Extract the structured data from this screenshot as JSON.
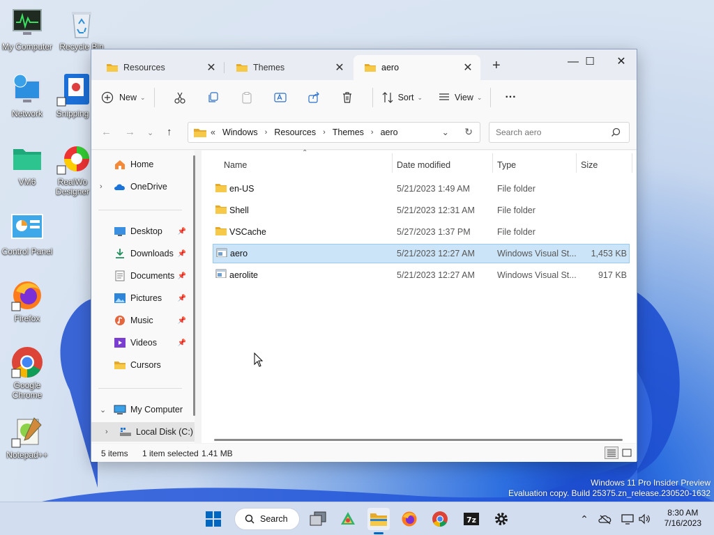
{
  "desktop": {
    "icons": [
      {
        "label": "My Computer",
        "icon": "monitor-icon"
      },
      {
        "label": "Recycle Bin",
        "icon": "recycle-bin-icon"
      },
      {
        "label": "Network",
        "icon": "network-icon"
      },
      {
        "label": "Snipping",
        "icon": "snipping-tool-icon"
      },
      {
        "label": "VM6",
        "icon": "folder-icon"
      },
      {
        "label": "RealWo Designer",
        "icon": "realworld-designer-icon"
      },
      {
        "label": "Control Panel",
        "icon": "control-panel-icon"
      },
      {
        "label": "Firefox",
        "icon": "firefox-icon"
      },
      {
        "label": "Google Chrome",
        "icon": "chrome-icon"
      },
      {
        "label": "Notepad++",
        "icon": "notepadpp-icon"
      }
    ],
    "watermark_line1": "Windows 11 Pro Insider Preview",
    "watermark_line2": "Evaluation copy. Build 25375.zn_release.230520-1632"
  },
  "window": {
    "tabs": [
      {
        "label": "Resources",
        "close": "✕"
      },
      {
        "label": "Themes",
        "close": "✕"
      },
      {
        "label": "aero",
        "close": "✕"
      }
    ],
    "new_tab": "+",
    "controls": {
      "minimize": "—",
      "maximize": "☐",
      "close": "✕"
    },
    "toolbar": {
      "new_label": "New",
      "sort_label": "Sort",
      "view_label": "View",
      "more_label": "···"
    },
    "address": {
      "overflow": "«",
      "crumbs": [
        "Windows",
        "Resources",
        "Themes",
        "aero"
      ],
      "search_placeholder": "Search aero"
    },
    "sidebar": {
      "home": "Home",
      "onedrive": "OneDrive",
      "quick_access": [
        {
          "label": "Desktop",
          "pinned": true
        },
        {
          "label": "Downloads",
          "pinned": true
        },
        {
          "label": "Documents",
          "pinned": true
        },
        {
          "label": "Pictures",
          "pinned": true
        },
        {
          "label": "Music",
          "pinned": true
        },
        {
          "label": "Videos",
          "pinned": true
        },
        {
          "label": "Cursors",
          "pinned": false
        }
      ],
      "my_computer": "My Computer",
      "local_disk": "Local Disk (C:)"
    },
    "columns": {
      "name": "Name",
      "date": "Date modified",
      "type": "Type",
      "size": "Size"
    },
    "files": [
      {
        "name": "en-US",
        "date": "5/21/2023 1:49 AM",
        "type": "File folder",
        "size": "",
        "kind": "folder"
      },
      {
        "name": "Shell",
        "date": "5/21/2023 12:31 AM",
        "type": "File folder",
        "size": "",
        "kind": "folder"
      },
      {
        "name": "VSCache",
        "date": "5/27/2023 1:37 PM",
        "type": "File folder",
        "size": "",
        "kind": "folder"
      },
      {
        "name": "aero",
        "date": "5/21/2023 12:27 AM",
        "type": "Windows Visual St...",
        "size": "1,453 KB",
        "kind": "file",
        "selected": true
      },
      {
        "name": "aerolite",
        "date": "5/21/2023 12:27 AM",
        "type": "Windows Visual St...",
        "size": "917 KB",
        "kind": "file"
      }
    ],
    "status": {
      "items": "5 items",
      "selected": "1 item selected",
      "size": "1.41 MB"
    }
  },
  "taskbar": {
    "search_label": "Search",
    "time": "8:30 AM",
    "date": "7/16/2023",
    "colors": {
      "accent": "#0067c0",
      "folder": "#f2c14e"
    }
  }
}
